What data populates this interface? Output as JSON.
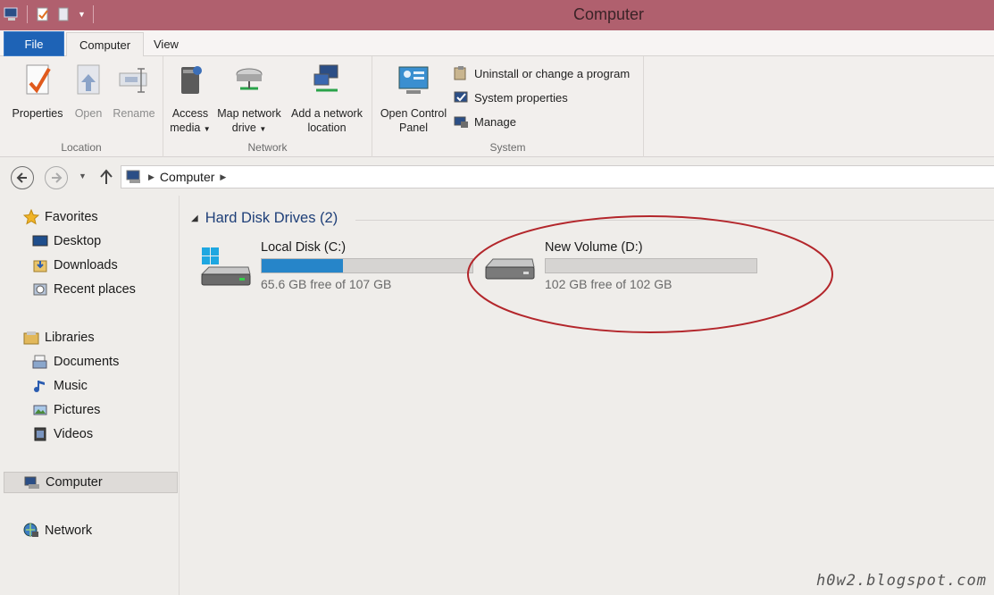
{
  "window": {
    "title": "Computer"
  },
  "tabs": [
    {
      "label": "File"
    },
    {
      "label": "Computer"
    },
    {
      "label": "View"
    }
  ],
  "ribbon": {
    "location": {
      "label": "Location",
      "properties": "Properties",
      "open": "Open",
      "rename": "Rename"
    },
    "network": {
      "label": "Network",
      "access_media_1": "Access",
      "access_media_2": "media",
      "map_drive_1": "Map network",
      "map_drive_2": "drive",
      "add_location_1": "Add a network",
      "add_location_2": "location"
    },
    "system": {
      "label": "System",
      "control_panel_1": "Open Control",
      "control_panel_2": "Panel",
      "uninstall": "Uninstall or change a program",
      "system_properties": "System properties",
      "manage": "Manage"
    }
  },
  "address": {
    "crumb": "Computer"
  },
  "nav": {
    "favorites": "Favorites",
    "desktop": "Desktop",
    "downloads": "Downloads",
    "recent": "Recent places",
    "libraries": "Libraries",
    "documents": "Documents",
    "music": "Music",
    "pictures": "Pictures",
    "videos": "Videos",
    "computer": "Computer",
    "network": "Network"
  },
  "content": {
    "section": "Hard Disk Drives (2)",
    "drives": [
      {
        "name": "Local Disk (C:)",
        "free": "65.6 GB free of 107 GB",
        "used_fraction": 0.387
      },
      {
        "name": "New Volume (D:)",
        "free": "102 GB free of 102 GB",
        "used_fraction": 0.0
      }
    ]
  },
  "watermark": "h0w2.blogspot.com",
  "colors": {
    "titlebar": "#b0606e",
    "file_tab": "#1e63b6",
    "usage_bar": "#2685c9",
    "annotation": "#b3262b"
  }
}
